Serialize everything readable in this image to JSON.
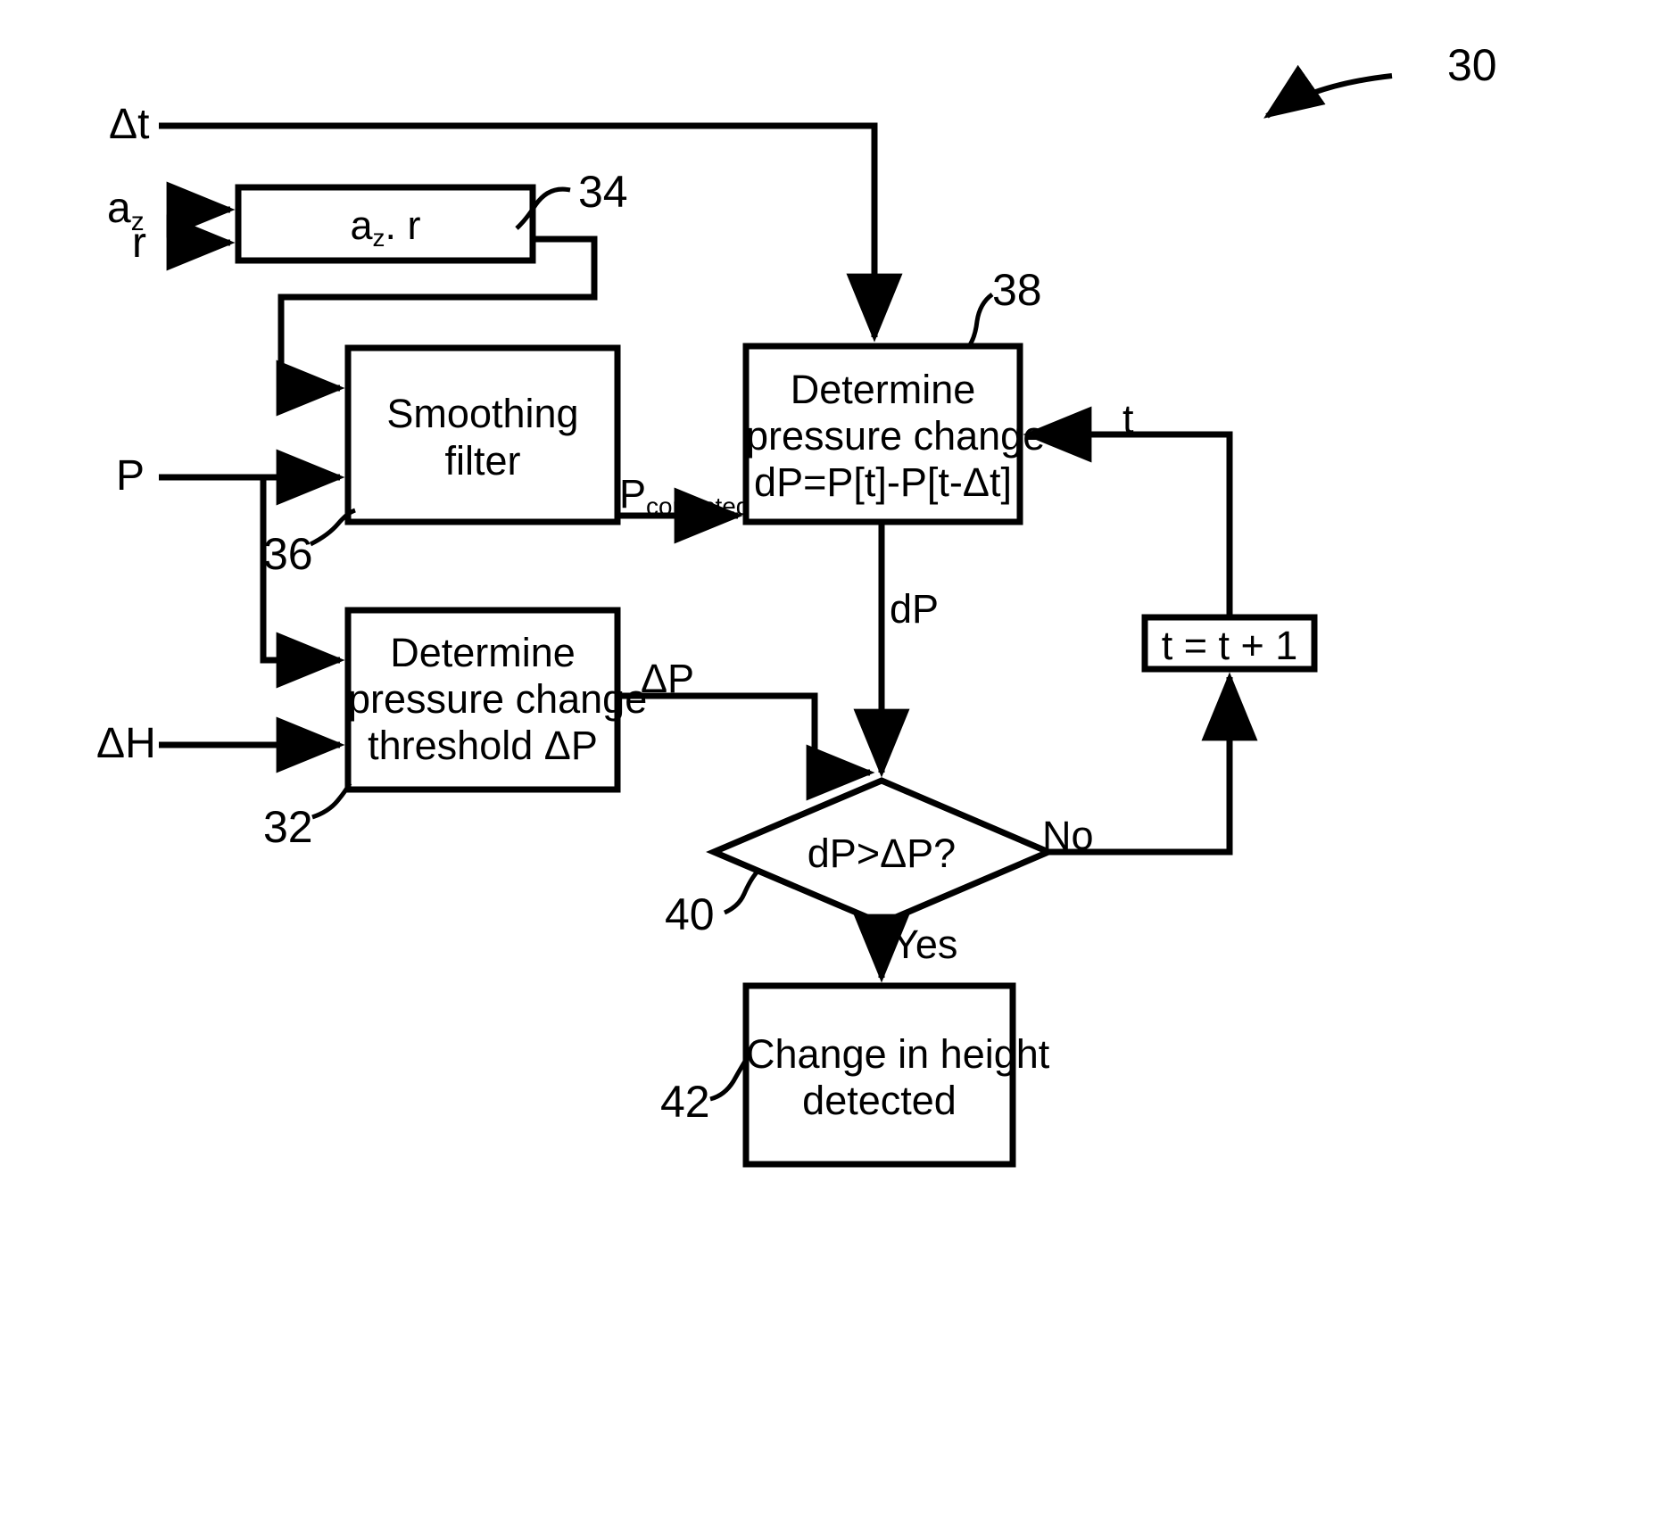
{
  "figure": {
    "reference_numeral": "30",
    "type": "patent-flowchart"
  },
  "inputs": [
    {
      "name": "delta-t",
      "label": "Δt"
    },
    {
      "name": "a-z",
      "label": "a",
      "subscript": "z"
    },
    {
      "name": "r",
      "label": "r"
    },
    {
      "name": "pressure",
      "label": "P"
    },
    {
      "name": "delta-h",
      "label": "ΔH"
    }
  ],
  "io_labels": {
    "delta_t": "Δt",
    "a_z_base": "a",
    "a_z_sub": "z",
    "r": "r",
    "p": "P",
    "delta_h": "ΔH"
  },
  "blocks": {
    "multiply": {
      "ref": "34",
      "text_base": "a",
      "text_sub": "z",
      "text_tail": ". r"
    },
    "smoothing_filter": {
      "ref": "36",
      "line1": "Smoothing",
      "line2": "filter"
    },
    "determine_pressure_change": {
      "ref": "38",
      "line1": "Determine",
      "line2": "pressure change",
      "line3": "dP=P[t]-P[t-Δt]"
    },
    "determine_threshold": {
      "ref": "32",
      "line1": "Determine",
      "line2": "pressure change",
      "line3": "threshold ΔP"
    },
    "increment_counter": {
      "text": "t = t + 1"
    },
    "decision": {
      "ref": "40",
      "text": "dP>ΔP?"
    },
    "height_detected": {
      "ref": "42",
      "line1": "Change in height",
      "line2": "detected"
    }
  },
  "edge_labels": {
    "p_corrected_base": "P",
    "p_corrected_sub": "corrected",
    "dp": "dP",
    "delta_p": "ΔP",
    "t": "t",
    "no": "No",
    "yes": "Yes"
  },
  "reference_numerals": {
    "figure": "30",
    "threshold_block": "32",
    "multiply_block": "34",
    "filter_block": "36",
    "pressure_change_block": "38",
    "decision_node": "40",
    "result_block": "42"
  },
  "colors": {
    "stroke": "#000000",
    "background": "#ffffff",
    "text": "#000000"
  }
}
